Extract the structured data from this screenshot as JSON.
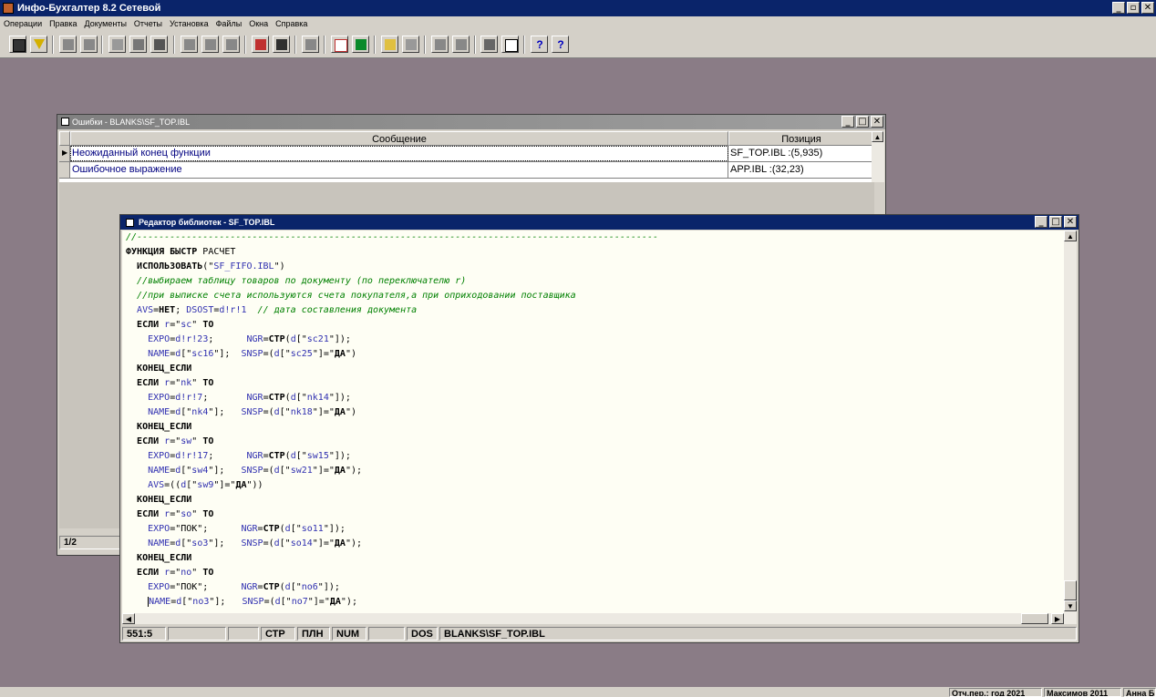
{
  "app": {
    "title": "Инфо-Бухгалтер 8.2 Сетевой",
    "min": "_",
    "max": "▫",
    "close": "✕"
  },
  "menu": [
    "Операции",
    "Правка",
    "Документы",
    "Отчеты",
    "Установка",
    "Файлы",
    "Окна",
    "Справка"
  ],
  "error_window": {
    "title": "Ошибки - BLANKS\\SF_TOP.IBL",
    "columns": [
      "Сообщение",
      "Позиция"
    ],
    "rows": [
      {
        "message": "Неожиданный конец функции",
        "position": "SF_TOP.IBL :(5,935)"
      },
      {
        "message": "Ошибочное выражение",
        "position": "APP.IBL :(32,23)"
      }
    ],
    "status": "1/2"
  },
  "editor": {
    "title": "Редактор библиотек - SF_TOP.IBL",
    "status": {
      "pos": "551:5",
      "cell2": "",
      "cell3": "",
      "ovr": "СТР",
      "pln": "ПЛН",
      "num": "NUM",
      "cell7": "",
      "enc": "DOS",
      "file": "BLANKS\\SF_TOP.IBL"
    }
  },
  "app_status": {
    "period": "Отч.пер.: год 2021",
    "user": "Максимов 2011",
    "extra": "Анна Б"
  }
}
